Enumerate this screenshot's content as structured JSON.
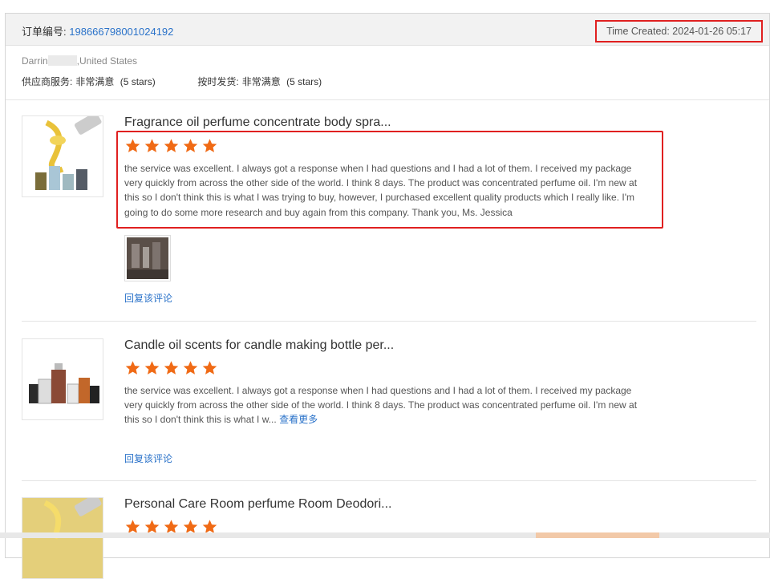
{
  "order": {
    "label": "订单编号:",
    "number": "198666798001024192",
    "time_created": "Time Created: 2024-01-26 05:17"
  },
  "buyer": {
    "name": "Darrin",
    "country": ",United States",
    "supplier_service_label": "供应商服务:",
    "supplier_service_value": "非常满意",
    "supplier_service_stars": "(5 stars)",
    "shipping_label": "按时发货:",
    "shipping_value": "非常满意",
    "shipping_stars": "(5 stars)"
  },
  "colors": {
    "star": "#f06a15",
    "link": "#2a72c9",
    "highlight": "#e02020"
  },
  "reviews": [
    {
      "title": "Fragrance oil perfume concentrate body spra...",
      "rating": 5,
      "comment": "the service was excellent. I always got a response when I had questions and I had a lot of them. I received my package very quickly from across the other side of the world. I think 8 days. The product was concentrated perfume oil. I'm new at this so I don't think this is what I was trying to buy, however, I purchased excellent quality products which I really like. I'm going to do some more research and buy again from this company. Thank you, Ms. Jessica",
      "reply_label": "回复该评论"
    },
    {
      "title": "Candle oil scents for candle making bottle per...",
      "rating": 5,
      "comment": "the service was excellent. I always got a response when I had questions and I had a lot of them. I received my package very quickly from across the other side of the world. I think 8 days. The product was concentrated perfume oil. I'm new at this so I don't think this is what I w...",
      "more_label": "查看更多",
      "reply_label": "回复该评论"
    },
    {
      "title": "Personal Care Room perfume Room Deodori...",
      "rating": 5
    }
  ]
}
